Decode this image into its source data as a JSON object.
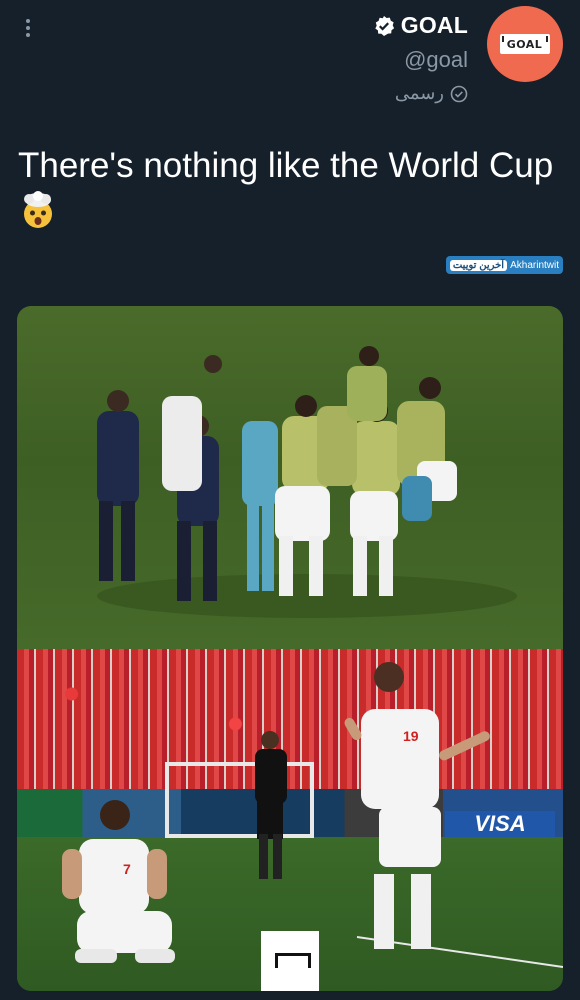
{
  "account": {
    "name": "GOAL",
    "handle": "@goal",
    "official_label": "رسمی",
    "avatar_text": "GOAL",
    "verified_icon": "verified-check-icon"
  },
  "tweet": {
    "text": "There's nothing like the World Cup",
    "emoji": "exploding-head-emoji"
  },
  "watermark": {
    "persian": "آخرین توییت",
    "latin": "Akharintwit"
  },
  "media": {
    "photo2_ad_text": "VISA",
    "jersey_numbers": [
      "19",
      "7"
    ]
  },
  "colors": {
    "background": "#15202b",
    "secondary_text": "#8b98a5",
    "avatar_bg": "#f06a4f"
  }
}
